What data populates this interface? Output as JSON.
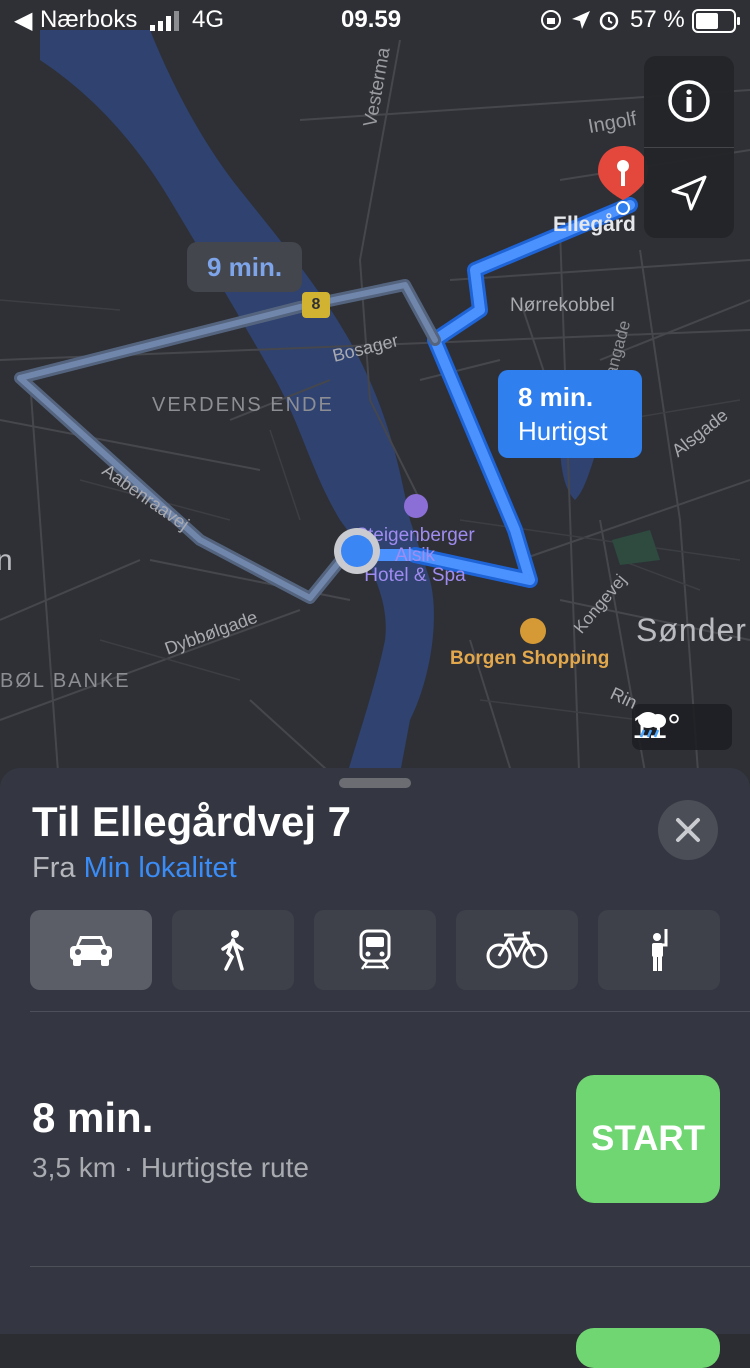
{
  "status_bar": {
    "back_label": "Nærboks",
    "network": "4G",
    "time": "09.59",
    "battery": "57 %"
  },
  "map": {
    "labels": {
      "vesterma": "Vesterma",
      "ingolf": "Ingolf",
      "ellegaard": "Ellegård",
      "norrekobbel": "Nørrekobbel",
      "bosager": "Bosager",
      "verdens_ende": "VERDENS ENDE",
      "aabenraavej": "Aabenraavej",
      "dybbolgade": "Dybbølgade",
      "bol_banke": "BØL BANKE",
      "danagade": "Dangade",
      "alsgade": "Alsgade",
      "kongevej": "Kongevej",
      "sonder": "Sønder",
      "rin": "Rin",
      "hotel": "Steigenberger\nAlsik\nHotel & Spa",
      "borgen": "Borgen Shopping",
      "edge_n": "n"
    },
    "route_alt_bubble": "9 min.",
    "route_main_bubble_time": "8 min.",
    "route_main_bubble_tag": "Hurtigst",
    "road_shield": "8",
    "weather_temp": "11°",
    "icons": {
      "info": "info-icon",
      "locate": "location-arrow-icon",
      "destination": "map-pin-icon",
      "weather": "rain-cloud-icon"
    }
  },
  "sheet": {
    "title": "Til Ellegårdvej 7",
    "from_prefix": "Fra",
    "from_location": "Min lokalitet",
    "modes": [
      {
        "name": "car",
        "icon": "car-icon",
        "active": true
      },
      {
        "name": "walk",
        "icon": "walk-icon",
        "active": false
      },
      {
        "name": "transit",
        "icon": "train-icon",
        "active": false
      },
      {
        "name": "bike",
        "icon": "bike-icon",
        "active": false
      },
      {
        "name": "rideshare",
        "icon": "hail-icon",
        "active": false
      }
    ],
    "route": {
      "time": "8 min.",
      "detail": "3,5 km · Hurtigste rute",
      "start_label": "START"
    }
  }
}
